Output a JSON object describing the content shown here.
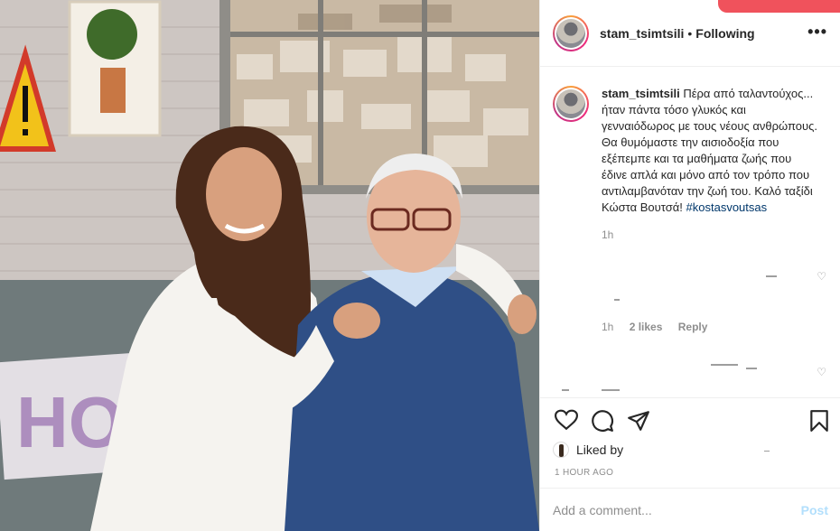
{
  "header": {
    "username": "stam_tsimtsili",
    "separator": "•",
    "follow_state": "Following",
    "more_icon": "more-horizontal-icon"
  },
  "caption": {
    "username": "stam_tsimtsili",
    "text": "Πέρα από ταλαντούχος... ήταν πάντα τόσο γλυκός και γενναιόδωρος με τους νέους ανθρώπους. Θα θυμόμαστε την αισιοδοξία που εξέπεμπε και τα μαθήματα ζωής που έδινε απλά και μόνο από τον τρόπο που αντιλαμβανόταν την ζωή του. Καλό ταξίδι Κώστα Βουτσά!",
    "hashtag": "#kostasvoutsas",
    "time": "1h"
  },
  "comments": [
    {
      "time": "1h",
      "likes": "2 likes",
      "reply": "Reply"
    }
  ],
  "actions": {
    "like_icon": "heart-icon",
    "comment_icon": "comment-icon",
    "share_icon": "paper-plane-icon",
    "save_icon": "bookmark-icon"
  },
  "likes": {
    "label": "Liked by"
  },
  "timestamp": "1 HOUR AGO",
  "add_comment": {
    "placeholder": "Add a comment...",
    "post_label": "Post"
  },
  "colors": {
    "link": "#00376b",
    "post_disabled": "#b2dffc",
    "muted": "#8e8e8e",
    "divider": "#efefef"
  }
}
